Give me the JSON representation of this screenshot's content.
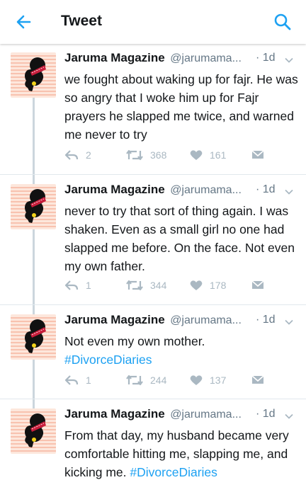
{
  "header": {
    "title": "Tweet",
    "back_icon": "arrow-left-icon",
    "search_icon": "search-icon"
  },
  "colors": {
    "accent": "#1da1f2",
    "text": "#14171a",
    "muted": "#657786",
    "action": "#aab8c2"
  },
  "tweets": [
    {
      "name": "Jaruma Magazine",
      "handle": "@jarumama...",
      "time": "· 1d",
      "text": "we fought about waking up for fajr. He was so angry that I woke him up for Fajr prayers he slapped me twice, and warned me never to try",
      "hashtag": "",
      "replies": "2",
      "retweets": "368",
      "likes": "161"
    },
    {
      "name": "Jaruma Magazine",
      "handle": "@jarumama...",
      "time": "· 1d",
      "text": "never to try that sort of thing again. I was shaken. Even as a small girl no one had slapped me before. On the face. Not even my own father.",
      "hashtag": "",
      "replies": "1",
      "retweets": "344",
      "likes": "178"
    },
    {
      "name": "Jaruma Magazine",
      "handle": "@jarumama...",
      "time": "· 1d",
      "text": "Not even my own mother.",
      "hashtag": "#DivorceDiaries",
      "replies": "1",
      "retweets": "244",
      "likes": "137"
    },
    {
      "name": "Jaruma Magazine",
      "handle": "@jarumama...",
      "time": "· 1d",
      "text": "From that day, my husband became very comfortable hitting me, slapping me, and kicking me.",
      "hashtag": "#DivorceDiaries",
      "replies": "",
      "retweets": "",
      "likes": ""
    }
  ]
}
